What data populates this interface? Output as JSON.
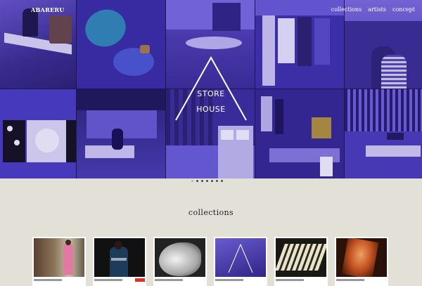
{
  "brand": "ABARERU",
  "nav": {
    "collections": "collections",
    "artists": "artists",
    "concept": "concept"
  },
  "logo": {
    "line1": "STORE",
    "line2": "HOUSE"
  },
  "slider": {
    "dot_count": 7,
    "active_index": 0
  },
  "section": {
    "title": "collections"
  },
  "collections": [
    {
      "name": "kimono-red",
      "has_badge": false
    },
    {
      "name": "kimono-black",
      "has_badge": true
    },
    {
      "name": "feather",
      "has_badge": false
    },
    {
      "name": "store-house",
      "has_badge": false
    },
    {
      "name": "sunlight",
      "has_badge": false
    },
    {
      "name": "orange-glow",
      "has_badge": false
    }
  ],
  "colors": {
    "overlay": "#3d2fb0",
    "background": "#e3e0d8"
  }
}
